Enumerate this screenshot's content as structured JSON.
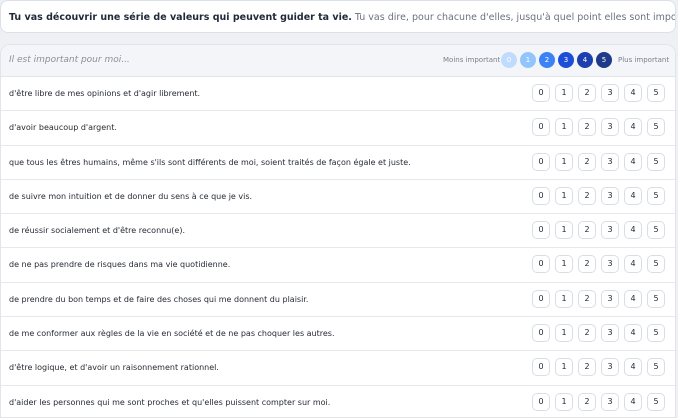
{
  "banner": {
    "bold": "Tu vas découvrir une série de valeurs qui peuvent guider ta vie.",
    "rest": " Tu vas dire, pour chacune d'elles, jusqu'à quel point elles sont importantes pour toi."
  },
  "header": {
    "prompt": "Il est important pour moi...",
    "low_label": "Moins important",
    "high_label": "Plus important",
    "scale": [
      {
        "label": "0",
        "color": "#bfdbfe"
      },
      {
        "label": "1",
        "color": "#93c5fd"
      },
      {
        "label": "2",
        "color": "#3b82f6"
      },
      {
        "label": "3",
        "color": "#1d4ed8"
      },
      {
        "label": "4",
        "color": "#1e40af"
      },
      {
        "label": "5",
        "color": "#1e3a8a"
      }
    ]
  },
  "options": [
    "0",
    "1",
    "2",
    "3",
    "4",
    "5"
  ],
  "items": [
    "d'être libre de mes opinions et d'agir librement.",
    "d'avoir beaucoup d'argent.",
    "que tous les êtres humains, même s'ils sont différents de moi, soient traités de façon égale et juste.",
    "de suivre mon intuition et de donner du sens à ce que je vis.",
    "de réussir socialement et d'être reconnu(e).",
    "de ne pas prendre de risques dans ma vie quotidienne.",
    "de prendre du bon temps et de faire des choses qui me donnent du plaisir.",
    "de me conformer aux règles de la vie en société et de ne pas choquer les autres.",
    "d'être logique, et d'avoir un raisonnement rationnel.",
    "d'aider les personnes qui me sont proches et qu'elles puissent compter sur moi."
  ]
}
